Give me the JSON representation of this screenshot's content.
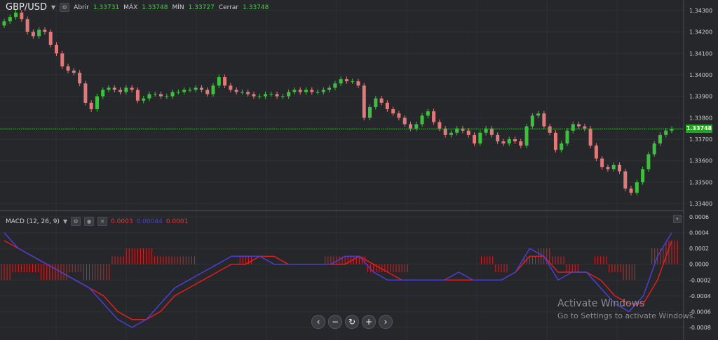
{
  "header": {
    "symbol": "GBP/USD",
    "open_label": "Abrir",
    "open_value": "1.33731",
    "high_label": "MÁX",
    "high_value": "1.33748",
    "low_label": "MÍN",
    "low_value": "1.33727",
    "close_label": "Cerrar",
    "close_value": "1.33748"
  },
  "price_tag": "1.33748",
  "macd_header": {
    "name": "MACD (12, 26, 9)",
    "v1": "0.0003",
    "v2": "0.00044",
    "v3": "0.0001"
  },
  "watermark": {
    "line1": "Activate Windows",
    "line2": "Go to Settings to activate Windows."
  },
  "nav": {
    "prev": "‹",
    "zoom_out": "−",
    "reset": "↻",
    "zoom_in": "+",
    "next": "›"
  },
  "colors": {
    "background": "#26272b",
    "up": "#3fbf3f",
    "down": "#e07a7a",
    "macd_line": "#4a3fd6",
    "signal_line": "#e01e1e",
    "histogram": "#e01e1e",
    "current_price_line": "#2fbf2f"
  },
  "chart_data": [
    {
      "type": "candlestick",
      "title": "GBP/USD",
      "ylim": [
        1.3337,
        1.3434
      ],
      "yticks": [
        "1.34300",
        "1.34200",
        "1.34100",
        "1.34000",
        "1.33900",
        "1.33800",
        "1.33700",
        "1.33600",
        "1.33500",
        "1.33400"
      ],
      "current_price": 1.33748,
      "close": [
        1.3425,
        1.3427,
        1.3429,
        1.3426,
        1.342,
        1.3418,
        1.3421,
        1.342,
        1.3414,
        1.341,
        1.3404,
        1.3402,
        1.3401,
        1.3396,
        1.3387,
        1.3384,
        1.339,
        1.3393,
        1.3394,
        1.3393,
        1.3392,
        1.3394,
        1.3393,
        1.3388,
        1.3389,
        1.3391,
        1.3391,
        1.339,
        1.339,
        1.3392,
        1.3392,
        1.3393,
        1.3393,
        1.3394,
        1.3393,
        1.3391,
        1.3395,
        1.3399,
        1.3395,
        1.3393,
        1.3392,
        1.3392,
        1.3391,
        1.339,
        1.339,
        1.3391,
        1.3391,
        1.339,
        1.339,
        1.3392,
        1.3393,
        1.3392,
        1.3393,
        1.3392,
        1.3392,
        1.3393,
        1.3394,
        1.3396,
        1.3398,
        1.3397,
        1.3397,
        1.3395,
        1.338,
        1.3385,
        1.3389,
        1.3387,
        1.3384,
        1.3382,
        1.338,
        1.3377,
        1.3375,
        1.3377,
        1.3381,
        1.3383,
        1.3378,
        1.3375,
        1.3372,
        1.3373,
        1.3375,
        1.3374,
        1.3372,
        1.3368,
        1.3373,
        1.3375,
        1.3372,
        1.3369,
        1.3368,
        1.337,
        1.3369,
        1.3367,
        1.3376,
        1.3381,
        1.3382,
        1.3376,
        1.3373,
        1.3365,
        1.3368,
        1.3374,
        1.3377,
        1.3376,
        1.3375,
        1.3367,
        1.3361,
        1.3357,
        1.3356,
        1.3358,
        1.3355,
        1.3347,
        1.3345,
        1.335,
        1.3356,
        1.3363,
        1.3368,
        1.3372,
        1.3374,
        1.33748
      ],
      "xlabel": "",
      "ylabel": ""
    },
    {
      "type": "line",
      "title": "MACD (12, 26, 9)",
      "ylim": [
        -0.0009,
        0.0006
      ],
      "yticks": [
        "0.0006",
        "0.0004",
        "0.0002",
        "0.0000",
        "-0.0002",
        "-0.0004",
        "-0.0006",
        "-0.0008"
      ],
      "series": [
        {
          "name": "MACD",
          "values": [
            0.0004,
            0.0002,
            0.0001,
            0.0,
            -0.0001,
            -0.0002,
            -0.0003,
            -0.0005,
            -0.0007,
            -0.0008,
            -0.0007,
            -0.0005,
            -0.0003,
            -0.0002,
            -0.0001,
            0.0,
            0.0001,
            0.0001,
            0.0001,
            0.0,
            0.0,
            0.0,
            0.0,
            0.0,
            0.0001,
            0.0001,
            -0.0001,
            -0.0002,
            -0.0002,
            -0.0002,
            -0.0002,
            -0.0002,
            -0.0001,
            -0.0002,
            -0.0002,
            -0.0002,
            -0.0001,
            0.0002,
            0.0001,
            -0.0002,
            -0.0001,
            -0.0001,
            -0.0003,
            -0.0005,
            -0.0006,
            -0.0004,
            0.0001,
            0.0004
          ]
        },
        {
          "name": "Signal",
          "values": [
            0.0003,
            0.0002,
            0.0001,
            0.0,
            -0.0001,
            -0.0002,
            -0.0003,
            -0.0004,
            -0.0006,
            -0.0007,
            -0.0007,
            -0.0006,
            -0.0004,
            -0.0003,
            -0.0002,
            -0.0001,
            0.0,
            0.0,
            0.0001,
            0.0001,
            0.0,
            0.0,
            0.0,
            0.0,
            0.0,
            0.0001,
            0.0,
            -0.0001,
            -0.0002,
            -0.0002,
            -0.0002,
            -0.0002,
            -0.0002,
            -0.0002,
            -0.0002,
            -0.0002,
            -0.0001,
            0.0001,
            0.0001,
            -0.0001,
            -0.0001,
            -0.0001,
            -0.0002,
            -0.0004,
            -0.0005,
            -0.0005,
            -0.0002,
            0.0003
          ]
        },
        {
          "name": "Histogram",
          "values": [
            -0.0002,
            -0.0001,
            -0.0001,
            -0.0002,
            -0.0002,
            -0.0001,
            -0.0002,
            -0.0002,
            0.0001,
            0.0002,
            0.0002,
            0.0001,
            0.0001,
            0.0001,
            0.0,
            0.0,
            0.0,
            0.0001,
            0.0,
            0.0,
            0.0,
            0.0,
            0.0,
            0.0001,
            0.0001,
            0.0001,
            -0.0001,
            -0.0001,
            -0.0001,
            0.0,
            0.0,
            0.0,
            0.0,
            0.0,
            0.0001,
            -0.0001,
            0.0,
            0.0001,
            0.0002,
            0.0001,
            -0.0001,
            0.0,
            0.0001,
            -0.0001,
            -0.0002,
            0.0,
            0.0002,
            0.0003
          ]
        }
      ]
    }
  ]
}
